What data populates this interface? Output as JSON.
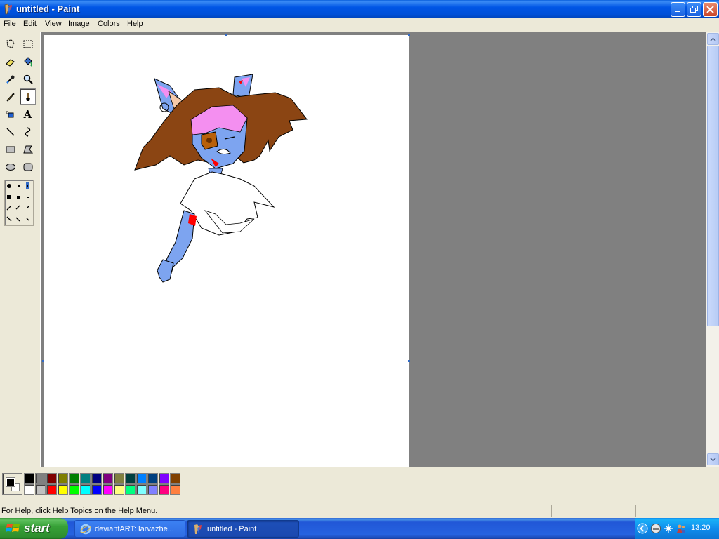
{
  "window": {
    "title": "untitled - Paint",
    "controls": {
      "minimize": "minimize-icon",
      "maximize": "restore-icon",
      "close": "close-icon"
    }
  },
  "menu": {
    "items": [
      {
        "label": "File"
      },
      {
        "label": "Edit"
      },
      {
        "label": "View"
      },
      {
        "label": "Image"
      },
      {
        "label": "Colors"
      },
      {
        "label": "Help"
      }
    ]
  },
  "toolbox": {
    "tools": [
      {
        "name": "free-form-select",
        "icon": "free-select-icon"
      },
      {
        "name": "select",
        "icon": "rect-select-icon"
      },
      {
        "name": "eraser",
        "icon": "eraser-icon"
      },
      {
        "name": "fill-with-color",
        "icon": "paint-bucket-icon"
      },
      {
        "name": "pick-color",
        "icon": "eyedropper-icon"
      },
      {
        "name": "magnifier",
        "icon": "magnifier-icon"
      },
      {
        "name": "pencil",
        "icon": "pencil-icon"
      },
      {
        "name": "brush",
        "icon": "brush-icon",
        "active": true
      },
      {
        "name": "airbrush",
        "icon": "airbrush-icon"
      },
      {
        "name": "text",
        "icon": "text-icon",
        "glyph": "A"
      },
      {
        "name": "line",
        "icon": "line-icon"
      },
      {
        "name": "curve",
        "icon": "curve-icon"
      },
      {
        "name": "rectangle",
        "icon": "rectangle-icon"
      },
      {
        "name": "polygon",
        "icon": "polygon-icon"
      },
      {
        "name": "ellipse",
        "icon": "ellipse-icon"
      },
      {
        "name": "rounded-rectangle",
        "icon": "rounded-rect-icon"
      }
    ]
  },
  "palette": {
    "foreground": "#000000",
    "background": "#ffffff",
    "top_row": [
      "#000000",
      "#808080",
      "#800000",
      "#808000",
      "#008000",
      "#008080",
      "#000080",
      "#800080",
      "#808040",
      "#004040",
      "#0080ff",
      "#004080",
      "#8000ff",
      "#804000"
    ],
    "bottom_row": [
      "#ffffff",
      "#c0c0c0",
      "#ff0000",
      "#ffff00",
      "#00ff00",
      "#00ffff",
      "#0000ff",
      "#ff00ff",
      "#ffff80",
      "#00ff80",
      "#80ffff",
      "#8080ff",
      "#ff0080",
      "#ff8040"
    ]
  },
  "status": {
    "help_text": "For Help, click Help Topics on the Help Menu."
  },
  "taskbar": {
    "start_label": "start",
    "tasks": [
      {
        "label": "deviantART: larvazhe...",
        "icon": "internet-explorer-icon",
        "active": false
      },
      {
        "label": "untitled - Paint",
        "icon": "paint-icon",
        "active": true
      }
    ],
    "clock": "13:20",
    "tray_icons": [
      "chevron-left-icon",
      "messenger-icon",
      "network-icon",
      "user-icon"
    ]
  },
  "colors": {
    "skin": "#7da4f0",
    "hair": "#8b4513",
    "hair_highlight": "#f48ff0",
    "ear_inner": "#f5c8a8",
    "eye": "#b8600a",
    "blood": "#ff0000",
    "workspace": "#808080"
  }
}
